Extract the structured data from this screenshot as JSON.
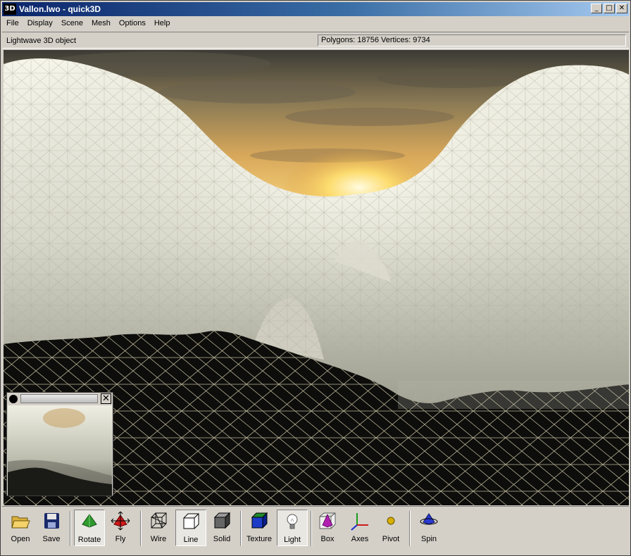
{
  "window": {
    "app_logo": "3D",
    "title": "Vallon.lwo - quick3D",
    "minimize_glyph": "_",
    "maximize_glyph": "□",
    "close_glyph": "✕"
  },
  "menu": [
    "File",
    "Display",
    "Scene",
    "Mesh",
    "Options",
    "Help"
  ],
  "info": {
    "object_type": "Lightwave 3D object",
    "stats": "Polygons: 18756  Vertices: 9734"
  },
  "minimap": {
    "close_glyph": "✕"
  },
  "toolbar": {
    "open": "Open",
    "save": "Save",
    "rotate": "Rotate",
    "fly": "Fly",
    "wire": "Wire",
    "line": "Line",
    "solid": "Solid",
    "texture": "Texture",
    "light": "Light",
    "box": "Box",
    "axes": "Axes",
    "pivot": "Pivot",
    "spin": "Spin"
  },
  "icons": {
    "open": "folder-open-icon",
    "save": "floppy-disk-icon",
    "rotate": "rotate-arrows-icon",
    "fly": "fly-arrows-icon",
    "wire": "wireframe-cube-icon",
    "line": "line-cube-icon",
    "solid": "solid-cube-icon",
    "texture": "texture-cube-icon",
    "light": "light-bulb-icon",
    "box": "bounding-box-icon",
    "axes": "axes-icon",
    "pivot": "pivot-point-icon",
    "spin": "spin-icon"
  },
  "colors": {
    "titlebar_start": "#0a246a",
    "titlebar_end": "#a6caf0",
    "chrome": "#d4d0c8",
    "mesh_light": "#ecebdf",
    "mesh_dark": "#0c0c0a",
    "wire_line": "#d8d2b0"
  },
  "toggles": {
    "rotate": true,
    "line": true,
    "light": true
  }
}
